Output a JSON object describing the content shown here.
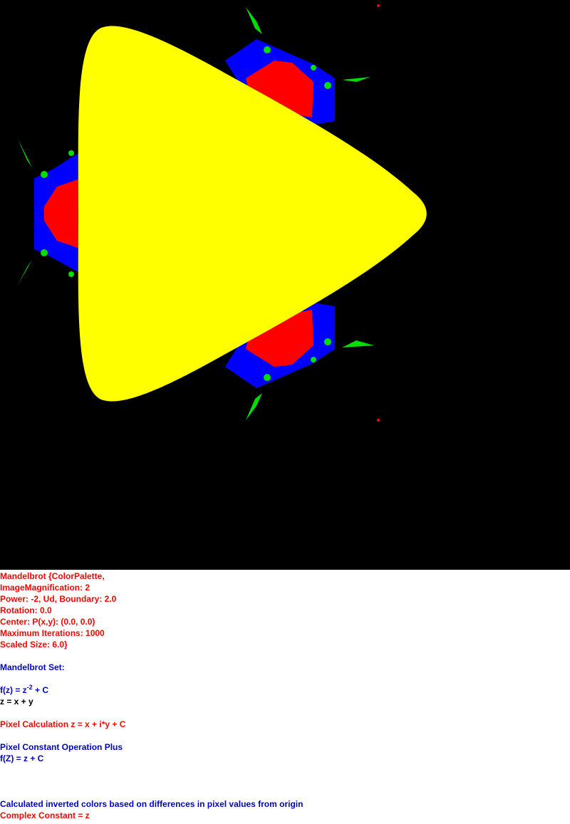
{
  "colors": {
    "background": "#000000",
    "main_body": "#ffff00",
    "bulbs": "#ff0000",
    "outer_bulbs": "#0000ff",
    "filaments": "#00dd00",
    "text_red": "#ff0000",
    "text_blue": "#0000cc",
    "text_black": "#000000"
  },
  "params": {
    "line1": "Mandelbrot {ColorPalette,",
    "line2": "ImageMagnification: 2",
    "line3": "Power: -2, Ud, Boundary: 2.0",
    "line4": "Rotation: 0.0",
    "line5": "Center: P(x,y): (0.0, 0.0)",
    "line6": "Maximum Iterations: 1000",
    "line7": "Scaled Size: 6.0}"
  },
  "set_title": "Mandelbrot Set:",
  "formula": {
    "lhs": "f(z) = z",
    "exponent": "-2",
    "rhs": " + C",
    "zdef": "z = x + y"
  },
  "pixel_calc": "Pixel Calculation z = x + i*y + C",
  "pixel_op": {
    "title": "Pixel Constant Operation Plus",
    "formula": "f(Z) = z + C"
  },
  "coloring": "Calculated inverted colors based on differences in pixel values from origin",
  "complex_constant": "Complex Constant = z"
}
